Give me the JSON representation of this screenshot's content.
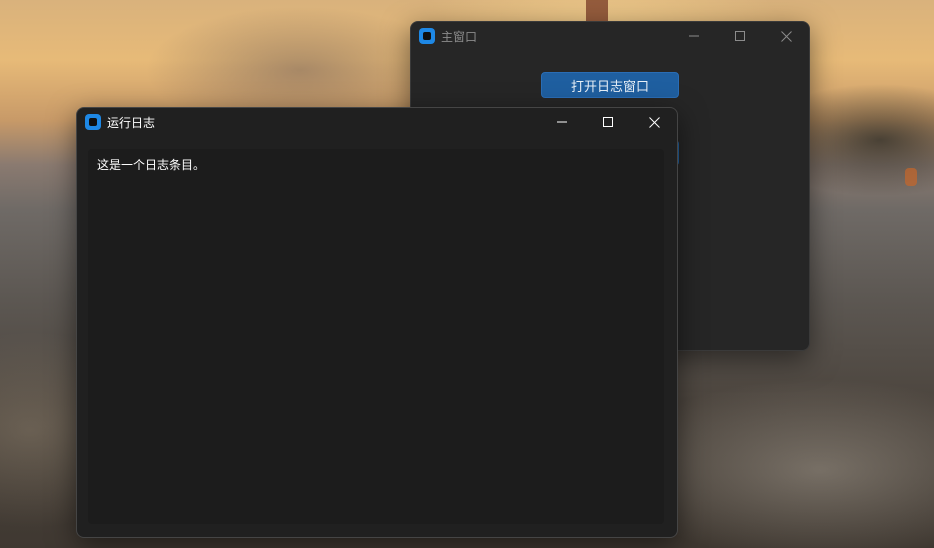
{
  "main_window": {
    "title": "主窗口",
    "open_log_button_label": "打开日志窗口"
  },
  "log_window": {
    "title": "运行日志",
    "entries": [
      "这是一个日志条目。"
    ]
  },
  "icons": {
    "app_icon": "app-icon",
    "minimize": "minimize-icon",
    "maximize": "maximize-icon",
    "close": "close-icon"
  },
  "colors": {
    "app_icon_accent": "#1e88e5",
    "primary_button": "#1f5fa0",
    "window_background": "#202020"
  }
}
